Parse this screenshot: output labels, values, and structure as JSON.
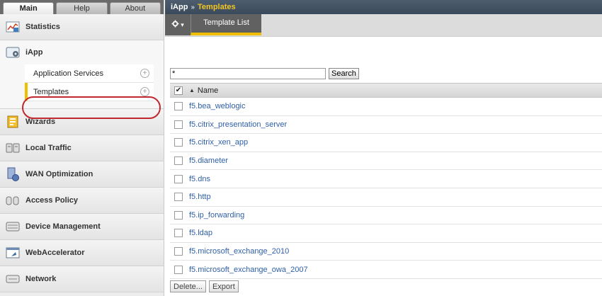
{
  "top_tabs": [
    {
      "label": "Main"
    },
    {
      "label": "Help"
    },
    {
      "label": "About"
    }
  ],
  "sidebar": {
    "statistics": {
      "label": "Statistics",
      "icon": "statistics-icon"
    },
    "iapp": {
      "label": "iApp",
      "icon": "iapp-icon",
      "children": [
        {
          "label": "Application Services"
        },
        {
          "label": "Templates"
        }
      ]
    },
    "items": [
      {
        "label": "Wizards",
        "icon": "wizards-icon"
      },
      {
        "label": "Local Traffic",
        "icon": "local-traffic-icon"
      },
      {
        "label": "WAN Optimization",
        "icon": "wan-optimization-icon"
      },
      {
        "label": "Access Policy",
        "icon": "access-policy-icon"
      },
      {
        "label": "Device Management",
        "icon": "device-management-icon"
      },
      {
        "label": "WebAccelerator",
        "icon": "webaccelerator-icon"
      },
      {
        "label": "Network",
        "icon": "network-icon"
      }
    ]
  },
  "breadcrumb": {
    "root": "iApp",
    "separator": "»",
    "current": "Templates"
  },
  "toolbar": {
    "gear_caret": "▾",
    "active_tab": "Template List"
  },
  "search": {
    "value": "*",
    "button_label": "Search"
  },
  "table": {
    "header": {
      "sort_indicator": "▲",
      "name_col": "Name",
      "select_all_checked": "✔"
    },
    "rows": [
      "f5.bea_weblogic",
      "f5.citrix_presentation_server",
      "f5.citrix_xen_app",
      "f5.diameter",
      "f5.dns",
      "f5.http",
      "f5.ip_forwarding",
      "f5.ldap",
      "f5.microsoft_exchange_2010",
      "f5.microsoft_exchange_owa_2007"
    ]
  },
  "footer": {
    "delete_label": "Delete...",
    "export_label": "Export"
  },
  "colors": {
    "accent_yellow": "#f0c000",
    "breadcrumb_bg": "#3b4a5b",
    "link_blue": "#2f5fa7",
    "highlight_red": "#c0282d"
  }
}
